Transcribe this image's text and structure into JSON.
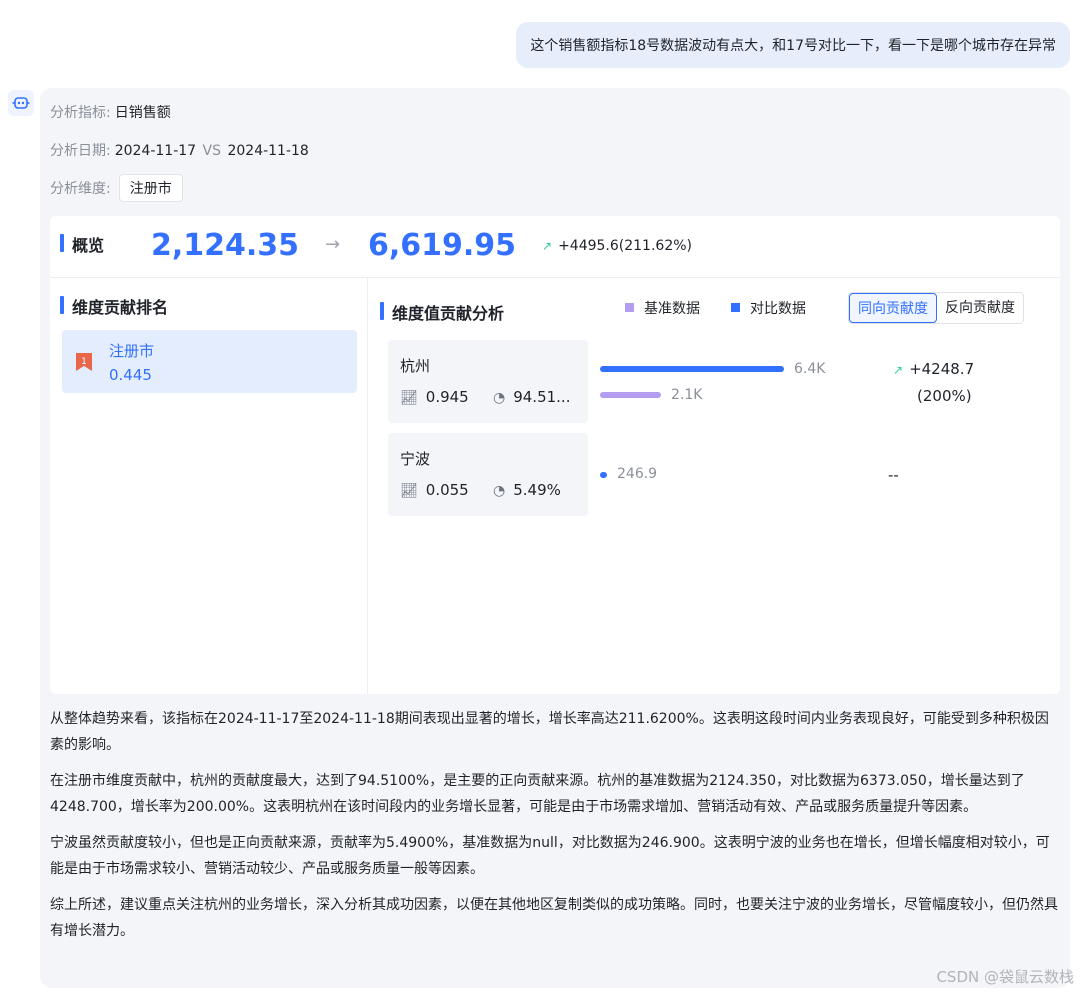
{
  "user_message": "这个销售额指标18号数据波动有点大，和17号对比一下，看一下是哪个城市存在异常",
  "meta": {
    "metric_label": "分析指标:",
    "metric_value": "日销售额",
    "date_label": "分析日期:",
    "date_from": "2024-11-17",
    "vs": "VS",
    "date_to": "2024-11-18",
    "dim_label": "分析维度:",
    "dim_value": "注册市"
  },
  "overview": {
    "title": "概览",
    "base_value": "2,124.35",
    "arrow": "→",
    "compare_value": "6,619.95",
    "change": "+4495.6(211.62%)"
  },
  "ranking": {
    "title": "维度贡献排名",
    "items": [
      {
        "rank": "1",
        "name": "注册市",
        "value": "0.445"
      }
    ]
  },
  "dimension_analysis": {
    "title": "维度值贡献分析",
    "legend_base": "基准数据",
    "legend_compare": "对比数据",
    "toggle_positive": "同向贡献度",
    "toggle_negative": "反向贡献度",
    "colors": {
      "base": "#b39df0",
      "compare": "#3370ff",
      "accent": "#3370ff",
      "up": "#2ecc8f"
    },
    "cities": [
      {
        "name": "杭州",
        "contribution": "0.945",
        "share": "94.51...",
        "compare_label": "6.4K",
        "base_label": "2.1K",
        "compare_value": 6373.05,
        "base_value": 2124.35,
        "delta": "+4248.7",
        "delta_pct": "(200%)"
      },
      {
        "name": "宁波",
        "contribution": "0.055",
        "share": "5.49%",
        "compare_label": "246.9",
        "compare_value": 246.9,
        "delta": "--"
      }
    ]
  },
  "analysis": {
    "p1": "从整体趋势来看，该指标在2024-11-17至2024-11-18期间表现出显著的增长，增长率高达211.6200%。这表明这段时间内业务表现良好，可能受到多种积极因素的影响。",
    "p2": "在注册市维度贡献中，杭州的贡献度最大，达到了94.5100%，是主要的正向贡献来源。杭州的基准数据为2124.350，对比数据为6373.050，增长量达到了4248.700，增长率为200.00%。这表明杭州在该时间段内的业务增长显著，可能是由于市场需求增加、营销活动有效、产品或服务质量提升等因素。",
    "p3": "宁波虽然贡献度较小，但也是正向贡献来源，贡献率为5.4900%，基准数据为null，对比数据为246.900。这表明宁波的业务也在增长，但增长幅度相对较小，可能是由于市场需求较小、营销活动较少、产品或服务质量一般等因素。",
    "p4": "综上所述，建议重点关注杭州的业务增长，深入分析其成功因素，以便在其他地区复制类似的成功策略。同时，也要关注宁波的业务增长，尽管幅度较小，但仍然具有增长潜力。"
  },
  "watermark": "CSDN @袋鼠云数栈"
}
